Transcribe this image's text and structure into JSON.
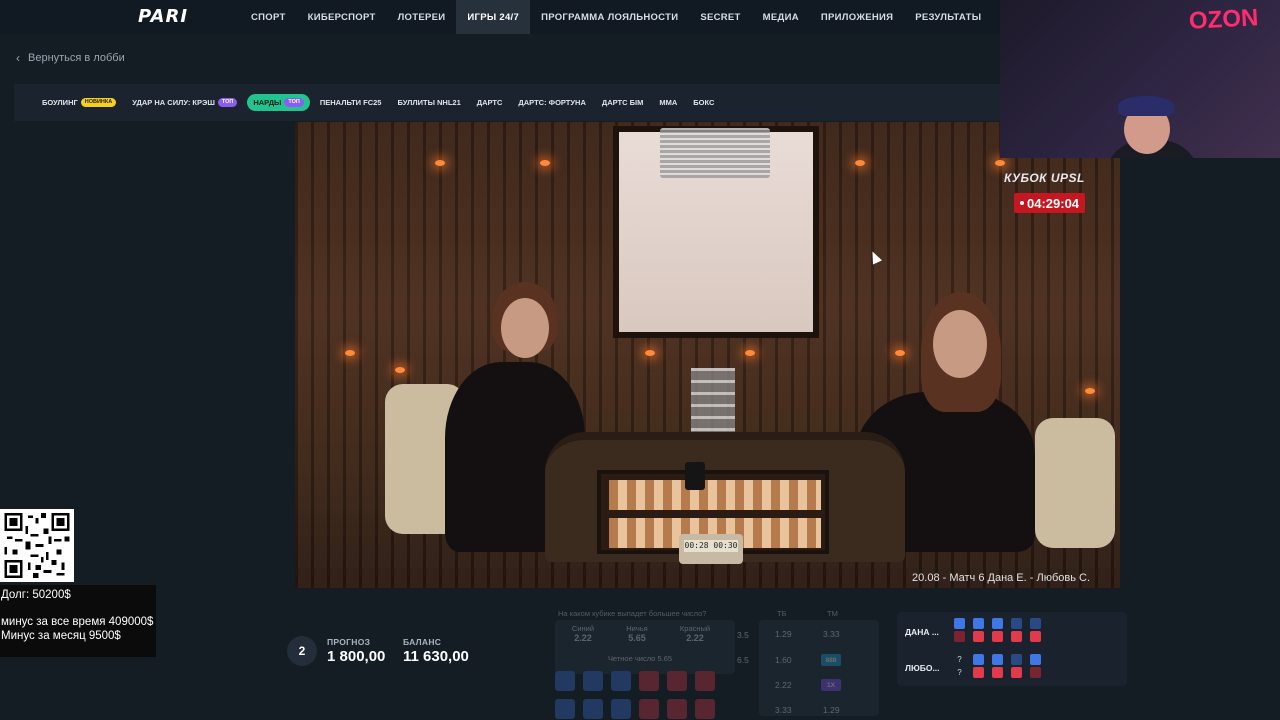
{
  "header": {
    "logo": "PARI",
    "nav": [
      {
        "label": "СПОРТ",
        "active": false
      },
      {
        "label": "КИБЕРСПОРТ",
        "active": false
      },
      {
        "label": "ЛОТЕРЕИ",
        "active": false
      },
      {
        "label": "ИГРЫ 24/7",
        "active": true
      },
      {
        "label": "ПРОГРАММА ЛОЯЛЬНОСТИ",
        "active": false
      },
      {
        "label": "SECRET",
        "active": false
      },
      {
        "label": "МЕДИА",
        "active": false
      },
      {
        "label": "ПРИЛОЖЕНИЯ",
        "active": false
      },
      {
        "label": "РЕЗУЛЬТАТЫ",
        "active": false
      }
    ]
  },
  "back_link": "Вернуться в лобби",
  "game_tabs": [
    {
      "label": "БОУЛИНГ",
      "badge": "НОВИНКА",
      "badge_type": "new",
      "selected": false
    },
    {
      "label": "УДАР НА СИЛУ: КРЭШ",
      "badge": "ТОП",
      "badge_type": "top",
      "selected": false
    },
    {
      "label": "НАРДЫ",
      "badge": "ТОП",
      "badge_type": "top",
      "selected": true
    },
    {
      "label": "ПЕНАЛЬТИ FC25",
      "badge": "",
      "selected": false
    },
    {
      "label": "БУЛЛИТЫ NHL21",
      "badge": "",
      "selected": false
    },
    {
      "label": "ДАРТС",
      "badge": "",
      "selected": false
    },
    {
      "label": "ДАРТС: ФОРТУНА",
      "badge": "",
      "selected": false
    },
    {
      "label": "ДАРТС БІМ",
      "badge": "",
      "selected": false
    },
    {
      "label": "ММА",
      "badge": "",
      "selected": false
    },
    {
      "label": "БОКС",
      "badge": "",
      "selected": false
    }
  ],
  "video": {
    "caption": "20.08 - Матч 6 Дана Е. - Любовь С.",
    "clock_display": "00:28 00:30"
  },
  "event": {
    "title": "КУБОК UPSL",
    "timer": "04:29:04"
  },
  "webcam": {
    "brand": "OZON"
  },
  "bet": {
    "number": "2",
    "forecast_label": "ПРОГНОЗ",
    "forecast_value": "1 800,00",
    "balance_label": "БАЛАНС",
    "balance_value": "11 630,00"
  },
  "odds": {
    "question": "На каком кубике выпадет большее число?",
    "cells": [
      {
        "label": "Синий",
        "value": "2.22"
      },
      {
        "label": "Ничья",
        "value": "5.65"
      },
      {
        "label": "Красный",
        "value": "2.22"
      }
    ],
    "even_label": "Четное число",
    "even_value": "5.65",
    "col_tb": "ТБ",
    "col_tm": "ТМ",
    "rows": [
      {
        "line": "3.5",
        "tb": "1.29",
        "tm": "3.33"
      },
      {
        "line": "6.5",
        "tb": "1.60",
        "tm": "888"
      },
      {
        "line": "",
        "tb": "2.22",
        "tm": "1X"
      },
      {
        "line": "",
        "tb": "3.33",
        "tm": "1.29"
      }
    ],
    "colors": {
      "blue": "#3c6fd6",
      "red": "#d83a4a",
      "pill_blue": "#2aa8e0",
      "pill_purple": "#8a5cf6"
    }
  },
  "players": [
    {
      "name": "ДАНА ..."
    },
    {
      "name": "ЛЮБО..."
    }
  ],
  "stream_overlay": {
    "debt": "Долг: 50200$",
    "minus_all": "минус за все время 409000$",
    "minus_month": "Минус за месяц 9500$"
  }
}
